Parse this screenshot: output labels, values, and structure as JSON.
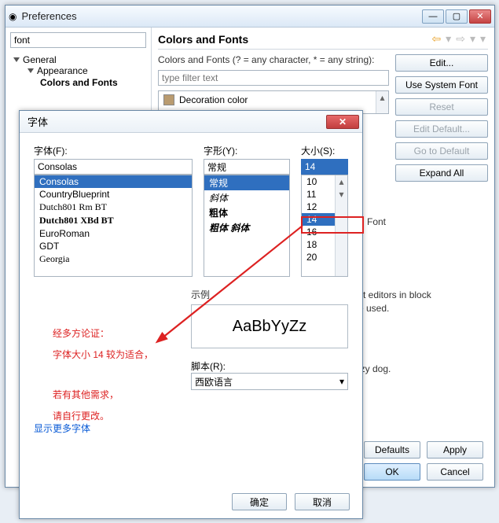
{
  "prefs": {
    "title": "Preferences",
    "filter_value": "font",
    "tree": {
      "general": "General",
      "appearance": "Appearance",
      "colors_fonts": "Colors and Fonts"
    },
    "section_title": "Colors and Fonts",
    "hint": "Colors and Fonts (? = any character, * = any string):",
    "type_filter_placeholder": "type filter text",
    "listitem": "Decoration color",
    "buttons": {
      "edit": "Edit...",
      "use_system": "Use System Font",
      "reset": "Reset",
      "edit_default": "Edit Default...",
      "go_default": "Go to Default",
      "expand_all": "Expand All"
    },
    "block_text1": "xt editors in block",
    "block_text2": "e used.",
    "block_text3": "izy dog.",
    "font_cut": "Font",
    "footer": {
      "defaults": "Defaults",
      "apply": "Apply",
      "ok": "OK",
      "cancel": "Cancel"
    }
  },
  "fontdlg": {
    "title": "字体",
    "labels": {
      "font": "字体(F):",
      "style": "字形(Y):",
      "size": "大小(S):"
    },
    "font_value": "Consolas",
    "font_list": [
      "Consolas",
      "CountryBlueprint",
      "Dutch801 Rm BT",
      "Dutch801 XBd BT",
      "EuroRoman",
      "GDT",
      "Georgia"
    ],
    "font_selected_index": 0,
    "style_value": "常规",
    "style_list": [
      "常规",
      "斜体",
      "粗体",
      "粗体 斜体"
    ],
    "style_selected_index": 0,
    "size_value": "14",
    "size_list": [
      "10",
      "11",
      "12",
      "14",
      "16",
      "18",
      "20"
    ],
    "size_selected_index": 3,
    "preview_label": "示例",
    "preview_text": "AaBbYyZz",
    "script_label": "脚本(R):",
    "script_value": "西欧语言",
    "more_fonts": "显示更多字体",
    "ok": "确定",
    "cancel": "取消"
  },
  "annot": {
    "line1": "经多方论证：",
    "line2": "字体大小 14 较为适合，",
    "line3": "若有其他需求，",
    "line4": "请自行更改。"
  }
}
